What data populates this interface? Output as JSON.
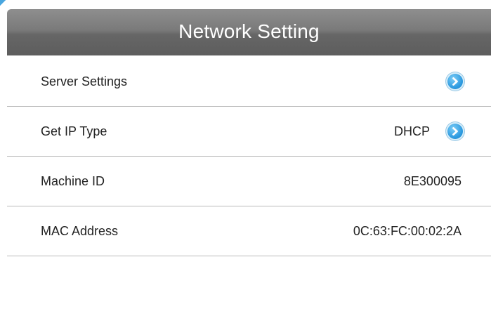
{
  "header": {
    "title": "Network Setting"
  },
  "rows": [
    {
      "label": "Server Settings",
      "value": "",
      "has_arrow": true
    },
    {
      "label": "Get IP Type",
      "value": "DHCP",
      "has_arrow": true
    },
    {
      "label": "Machine ID",
      "value": "8E300095",
      "has_arrow": false
    },
    {
      "label": "MAC Address",
      "value": "0C:63:FC:00:02:2A",
      "has_arrow": false
    }
  ],
  "icons": {
    "row_arrow": "chevron-right-circle-icon"
  },
  "colors": {
    "title_bar": "#6f6f6f",
    "accent_arrow": "#2e9be0",
    "divider": "#b9b9b9",
    "text": "#222222"
  }
}
